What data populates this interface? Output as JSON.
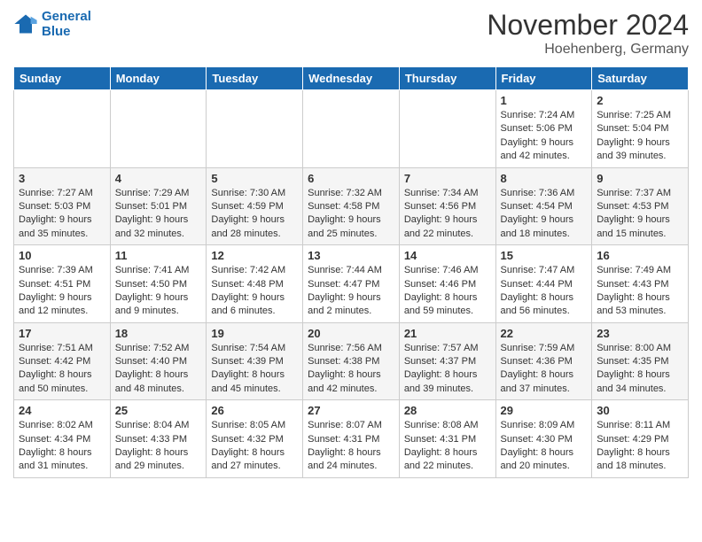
{
  "header": {
    "logo_line1": "General",
    "logo_line2": "Blue",
    "title": "November 2024",
    "subtitle": "Hoehenberg, Germany"
  },
  "days_of_week": [
    "Sunday",
    "Monday",
    "Tuesday",
    "Wednesday",
    "Thursday",
    "Friday",
    "Saturday"
  ],
  "weeks": [
    [
      {
        "day": "",
        "info": ""
      },
      {
        "day": "",
        "info": ""
      },
      {
        "day": "",
        "info": ""
      },
      {
        "day": "",
        "info": ""
      },
      {
        "day": "",
        "info": ""
      },
      {
        "day": "1",
        "info": "Sunrise: 7:24 AM\nSunset: 5:06 PM\nDaylight: 9 hours\nand 42 minutes."
      },
      {
        "day": "2",
        "info": "Sunrise: 7:25 AM\nSunset: 5:04 PM\nDaylight: 9 hours\nand 39 minutes."
      }
    ],
    [
      {
        "day": "3",
        "info": "Sunrise: 7:27 AM\nSunset: 5:03 PM\nDaylight: 9 hours\nand 35 minutes."
      },
      {
        "day": "4",
        "info": "Sunrise: 7:29 AM\nSunset: 5:01 PM\nDaylight: 9 hours\nand 32 minutes."
      },
      {
        "day": "5",
        "info": "Sunrise: 7:30 AM\nSunset: 4:59 PM\nDaylight: 9 hours\nand 28 minutes."
      },
      {
        "day": "6",
        "info": "Sunrise: 7:32 AM\nSunset: 4:58 PM\nDaylight: 9 hours\nand 25 minutes."
      },
      {
        "day": "7",
        "info": "Sunrise: 7:34 AM\nSunset: 4:56 PM\nDaylight: 9 hours\nand 22 minutes."
      },
      {
        "day": "8",
        "info": "Sunrise: 7:36 AM\nSunset: 4:54 PM\nDaylight: 9 hours\nand 18 minutes."
      },
      {
        "day": "9",
        "info": "Sunrise: 7:37 AM\nSunset: 4:53 PM\nDaylight: 9 hours\nand 15 minutes."
      }
    ],
    [
      {
        "day": "10",
        "info": "Sunrise: 7:39 AM\nSunset: 4:51 PM\nDaylight: 9 hours\nand 12 minutes."
      },
      {
        "day": "11",
        "info": "Sunrise: 7:41 AM\nSunset: 4:50 PM\nDaylight: 9 hours\nand 9 minutes."
      },
      {
        "day": "12",
        "info": "Sunrise: 7:42 AM\nSunset: 4:48 PM\nDaylight: 9 hours\nand 6 minutes."
      },
      {
        "day": "13",
        "info": "Sunrise: 7:44 AM\nSunset: 4:47 PM\nDaylight: 9 hours\nand 2 minutes."
      },
      {
        "day": "14",
        "info": "Sunrise: 7:46 AM\nSunset: 4:46 PM\nDaylight: 8 hours\nand 59 minutes."
      },
      {
        "day": "15",
        "info": "Sunrise: 7:47 AM\nSunset: 4:44 PM\nDaylight: 8 hours\nand 56 minutes."
      },
      {
        "day": "16",
        "info": "Sunrise: 7:49 AM\nSunset: 4:43 PM\nDaylight: 8 hours\nand 53 minutes."
      }
    ],
    [
      {
        "day": "17",
        "info": "Sunrise: 7:51 AM\nSunset: 4:42 PM\nDaylight: 8 hours\nand 50 minutes."
      },
      {
        "day": "18",
        "info": "Sunrise: 7:52 AM\nSunset: 4:40 PM\nDaylight: 8 hours\nand 48 minutes."
      },
      {
        "day": "19",
        "info": "Sunrise: 7:54 AM\nSunset: 4:39 PM\nDaylight: 8 hours\nand 45 minutes."
      },
      {
        "day": "20",
        "info": "Sunrise: 7:56 AM\nSunset: 4:38 PM\nDaylight: 8 hours\nand 42 minutes."
      },
      {
        "day": "21",
        "info": "Sunrise: 7:57 AM\nSunset: 4:37 PM\nDaylight: 8 hours\nand 39 minutes."
      },
      {
        "day": "22",
        "info": "Sunrise: 7:59 AM\nSunset: 4:36 PM\nDaylight: 8 hours\nand 37 minutes."
      },
      {
        "day": "23",
        "info": "Sunrise: 8:00 AM\nSunset: 4:35 PM\nDaylight: 8 hours\nand 34 minutes."
      }
    ],
    [
      {
        "day": "24",
        "info": "Sunrise: 8:02 AM\nSunset: 4:34 PM\nDaylight: 8 hours\nand 31 minutes."
      },
      {
        "day": "25",
        "info": "Sunrise: 8:04 AM\nSunset: 4:33 PM\nDaylight: 8 hours\nand 29 minutes."
      },
      {
        "day": "26",
        "info": "Sunrise: 8:05 AM\nSunset: 4:32 PM\nDaylight: 8 hours\nand 27 minutes."
      },
      {
        "day": "27",
        "info": "Sunrise: 8:07 AM\nSunset: 4:31 PM\nDaylight: 8 hours\nand 24 minutes."
      },
      {
        "day": "28",
        "info": "Sunrise: 8:08 AM\nSunset: 4:31 PM\nDaylight: 8 hours\nand 22 minutes."
      },
      {
        "day": "29",
        "info": "Sunrise: 8:09 AM\nSunset: 4:30 PM\nDaylight: 8 hours\nand 20 minutes."
      },
      {
        "day": "30",
        "info": "Sunrise: 8:11 AM\nSunset: 4:29 PM\nDaylight: 8 hours\nand 18 minutes."
      }
    ]
  ]
}
